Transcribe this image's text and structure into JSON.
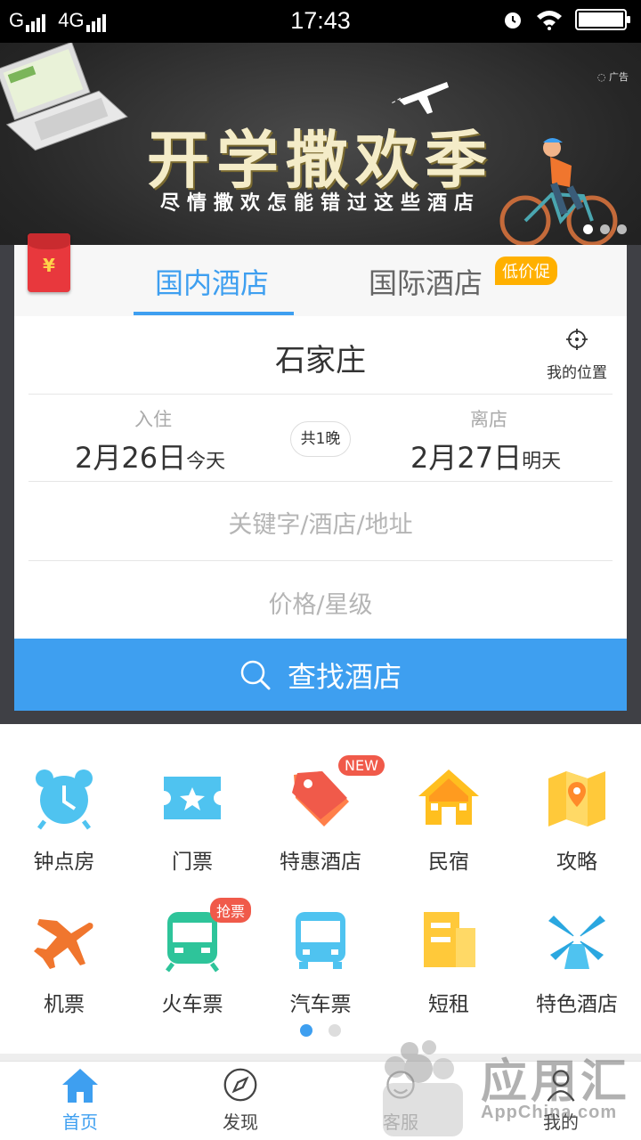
{
  "status_bar": {
    "network": "G",
    "network2": "4G",
    "time": "17:43"
  },
  "banner": {
    "title": "开学撒欢季",
    "subtitle": "尽情撒欢怎能错过这些酒店",
    "ad_label": "广告"
  },
  "booking": {
    "redpack_symbol": "¥",
    "tabs": [
      {
        "label": "国内酒店"
      },
      {
        "label": "国际酒店"
      }
    ],
    "promo_tag": "低价促",
    "city": "石家庄",
    "location_label": "我的位置",
    "checkin": {
      "label": "入住",
      "date": "2月26日",
      "note": "今天"
    },
    "checkout": {
      "label": "离店",
      "date": "2月27日",
      "note": "明天"
    },
    "nights": "共1晚",
    "keyword_placeholder": "关键字/酒店/地址",
    "price_placeholder": "价格/星级",
    "search_label": "查找酒店"
  },
  "services": [
    {
      "label": "钟点房",
      "icon": "alarm-clock-icon"
    },
    {
      "label": "门票",
      "icon": "ticket-icon"
    },
    {
      "label": "特惠酒店",
      "icon": "price-tag-icon",
      "badge": "NEW"
    },
    {
      "label": "民宿",
      "icon": "house-icon"
    },
    {
      "label": "攻略",
      "icon": "map-icon"
    },
    {
      "label": "机票",
      "icon": "airplane-icon"
    },
    {
      "label": "火车票",
      "icon": "train-icon",
      "badge": "抢票"
    },
    {
      "label": "汽车票",
      "icon": "bus-icon"
    },
    {
      "label": "短租",
      "icon": "building-icon"
    },
    {
      "label": "特色酒店",
      "icon": "windmill-icon"
    }
  ],
  "nav": [
    {
      "label": "首页",
      "icon": "home-icon"
    },
    {
      "label": "发现",
      "icon": "compass-icon"
    },
    {
      "label": "客服",
      "icon": "headset-icon"
    },
    {
      "label": "我的",
      "icon": "user-icon"
    }
  ],
  "watermark": {
    "text": "应用汇",
    "sub": "AppChina.com"
  },
  "colors": {
    "accent": "#3e9ff0",
    "promo": "#ffb000",
    "badge": "#f05a4a"
  }
}
